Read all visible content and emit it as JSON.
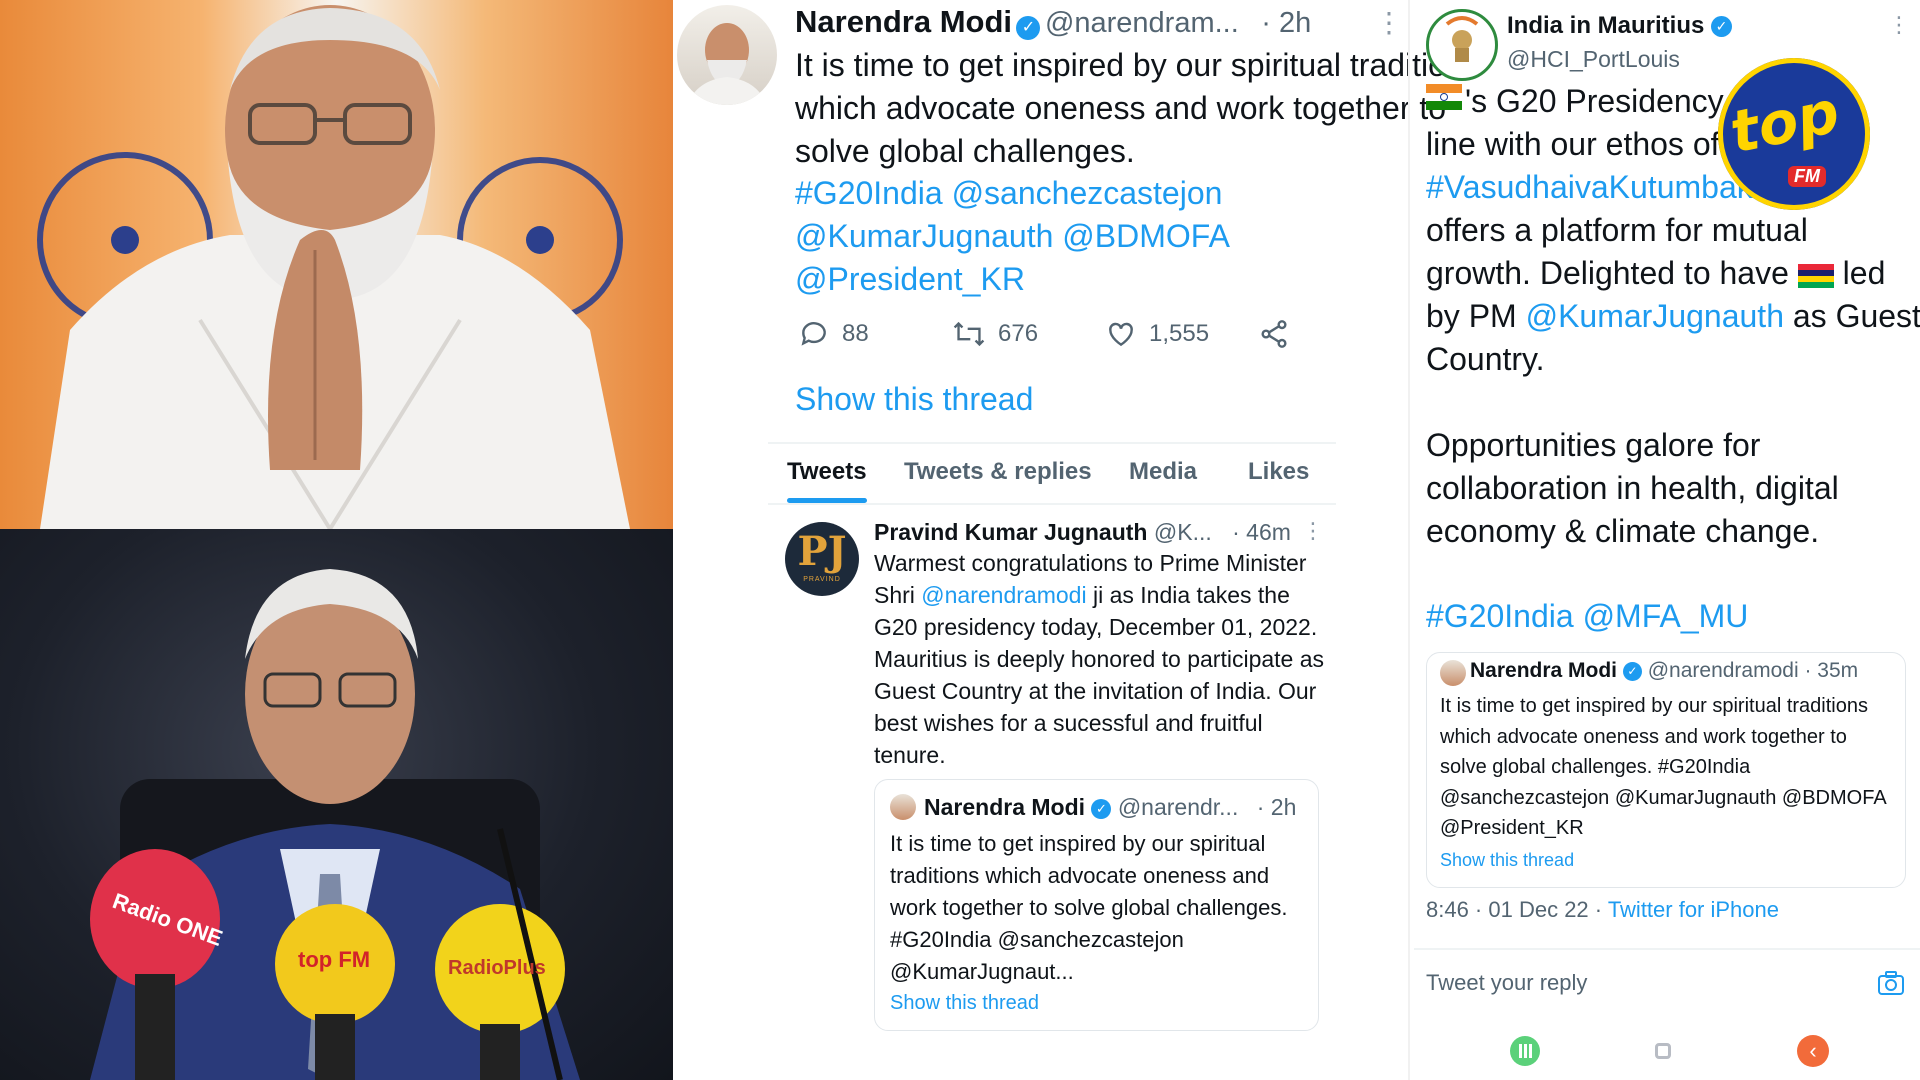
{
  "modi_tweet": {
    "name": "Narendra Modi",
    "handle": "@narendram...",
    "time": "· 2h",
    "text": "It is time to get inspired by our spiritual traditions which advocate oneness and work together to solve global challenges.",
    "tags": [
      "#G20India @sanchezcastejon",
      "@KumarJugnauth @BDMOFA",
      "@President_KR"
    ],
    "reply_count": "88",
    "retweet_count": "676",
    "like_count": "1,555",
    "show_thread": "Show this thread"
  },
  "tabs": [
    {
      "label": "Tweets"
    },
    {
      "label": "Tweets & replies"
    },
    {
      "label": "Media"
    },
    {
      "label": "Likes"
    }
  ],
  "jugnauth_tweet": {
    "avatar_text": "PJ",
    "avatar_sub": "PRAVIND",
    "name": "Pravind Kumar Jugnauth",
    "handle": "@K...",
    "time": "· 46m",
    "text_before": "Warmest congratulations to Prime Minister Shri ",
    "mention": "@narendramodi",
    "text_after": " ji as India takes the G20 presidency today, December 01, 2022. Mauritius is deeply honored to participate as Guest Country at the invitation of India. Our best wishes for a sucessful and fruitful tenure.",
    "quote": {
      "name": "Narendra Modi",
      "handle": "@narendr...",
      "time": "· 2h",
      "text": "It is time to get inspired by our spiritual traditions which advocate oneness and work together to solve global challenges. #G20India @sanchezcastejon @KumarJugnaut...",
      "show_thread": "Show this thread"
    }
  },
  "india_tweet": {
    "name": "India in Mauritius",
    "handle": "@HCI_PortLouis",
    "line1": "'s G20 Presidency",
    "line2": "line with our ethos of",
    "hashtag_line": "#VasudhaivaKutumbakam",
    "line3": "offers a platform for mutual",
    "line4a": "growth. Delighted to have ",
    "line4b": " led",
    "line5a": "by PM ",
    "line5_mention": "@KumarJugnauth",
    "line5b": " as Guest",
    "line6": "Country.",
    "para2": "Opportunities galore for collaboration in health, digital economy & climate change.",
    "tags": "#G20India @MFA_MU",
    "quote": {
      "name": "Narendra Modi",
      "handle": "@narendramodi · 35m",
      "text": "It is time to get inspired by our spiritual traditions which advocate oneness and work together to solve global challenges. #G20India @sanchezcastejon @KumarJugnauth @BDMOFA @President_KR",
      "show_thread": "Show this thread"
    },
    "meta": "8:46 · 01 Dec 22 · ",
    "source": "Twitter for iPhone",
    "reply_placeholder": "Tweet your reply"
  },
  "overlay": {
    "logo_text": "top",
    "logo_sub": "FM"
  },
  "mic_labels": [
    "Radio ONE",
    "top FM",
    "RadioPlus"
  ]
}
